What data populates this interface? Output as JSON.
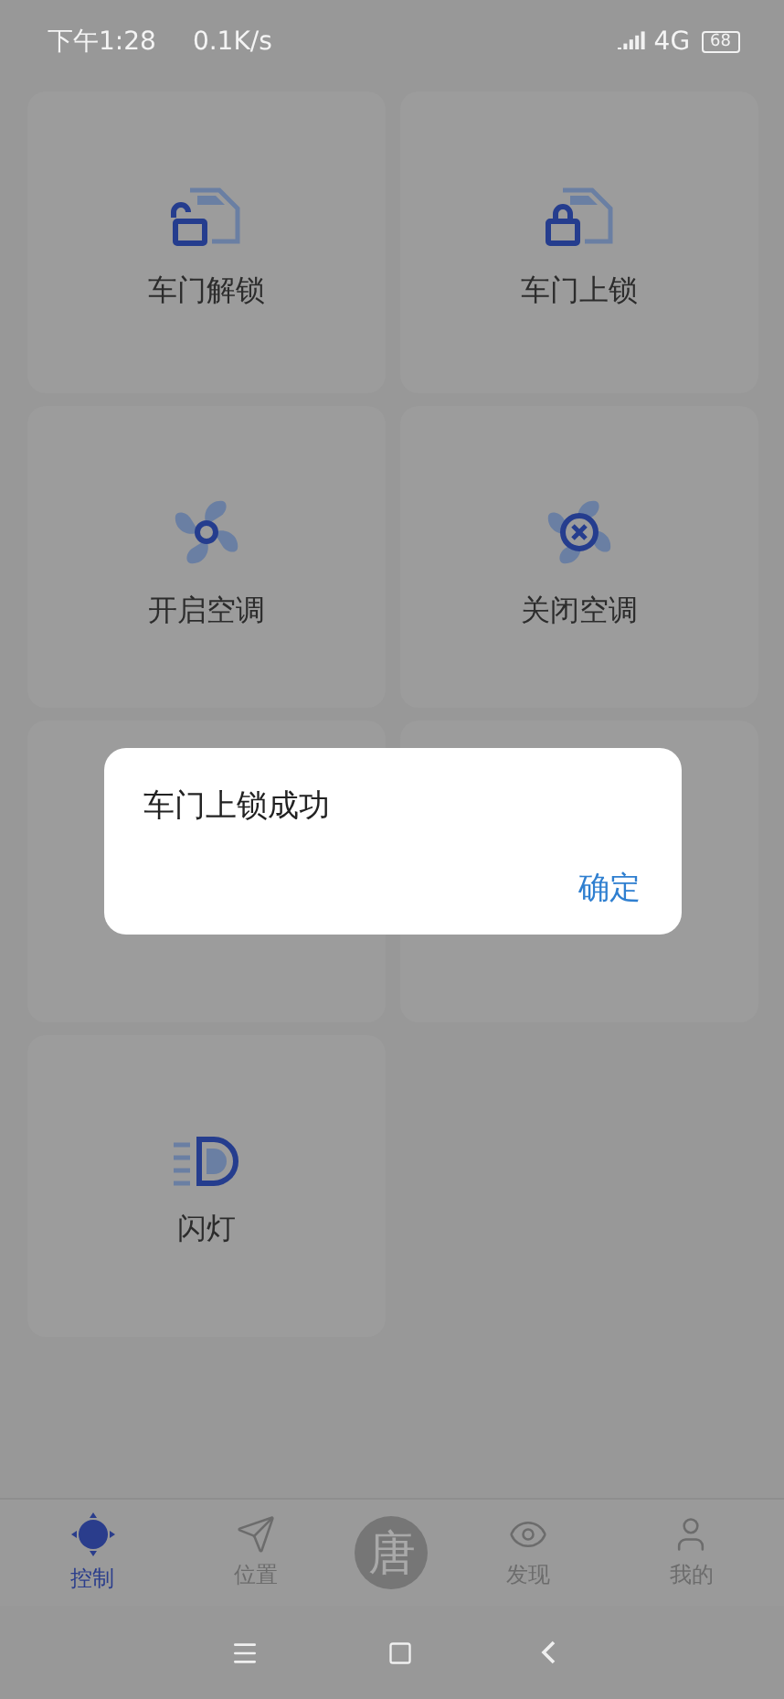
{
  "status_bar": {
    "time": "下午1:28",
    "speed": "0.1K/s",
    "network": "4G",
    "battery": "68"
  },
  "cards": [
    {
      "kind": "unlock",
      "label": "车门解锁"
    },
    {
      "kind": "lock",
      "label": "车门上锁"
    },
    {
      "kind": "fan",
      "label": "开启空调"
    },
    {
      "kind": "fanoff",
      "label": "关闭空调"
    },
    {
      "kind": "covered"
    },
    {
      "kind": "covered"
    },
    {
      "kind": "light",
      "label": "闪灯"
    }
  ],
  "tabs": [
    {
      "kind": "control",
      "label": "控制",
      "selected": true
    },
    {
      "kind": "location",
      "label": "位置",
      "selected": false
    },
    {
      "kind": "logo",
      "label": "唐",
      "selected": false
    },
    {
      "kind": "discover",
      "label": "发现",
      "selected": false
    },
    {
      "kind": "profile",
      "label": "我的",
      "selected": false
    }
  ],
  "dialog": {
    "message": "车门上锁成功",
    "button": "确定"
  }
}
